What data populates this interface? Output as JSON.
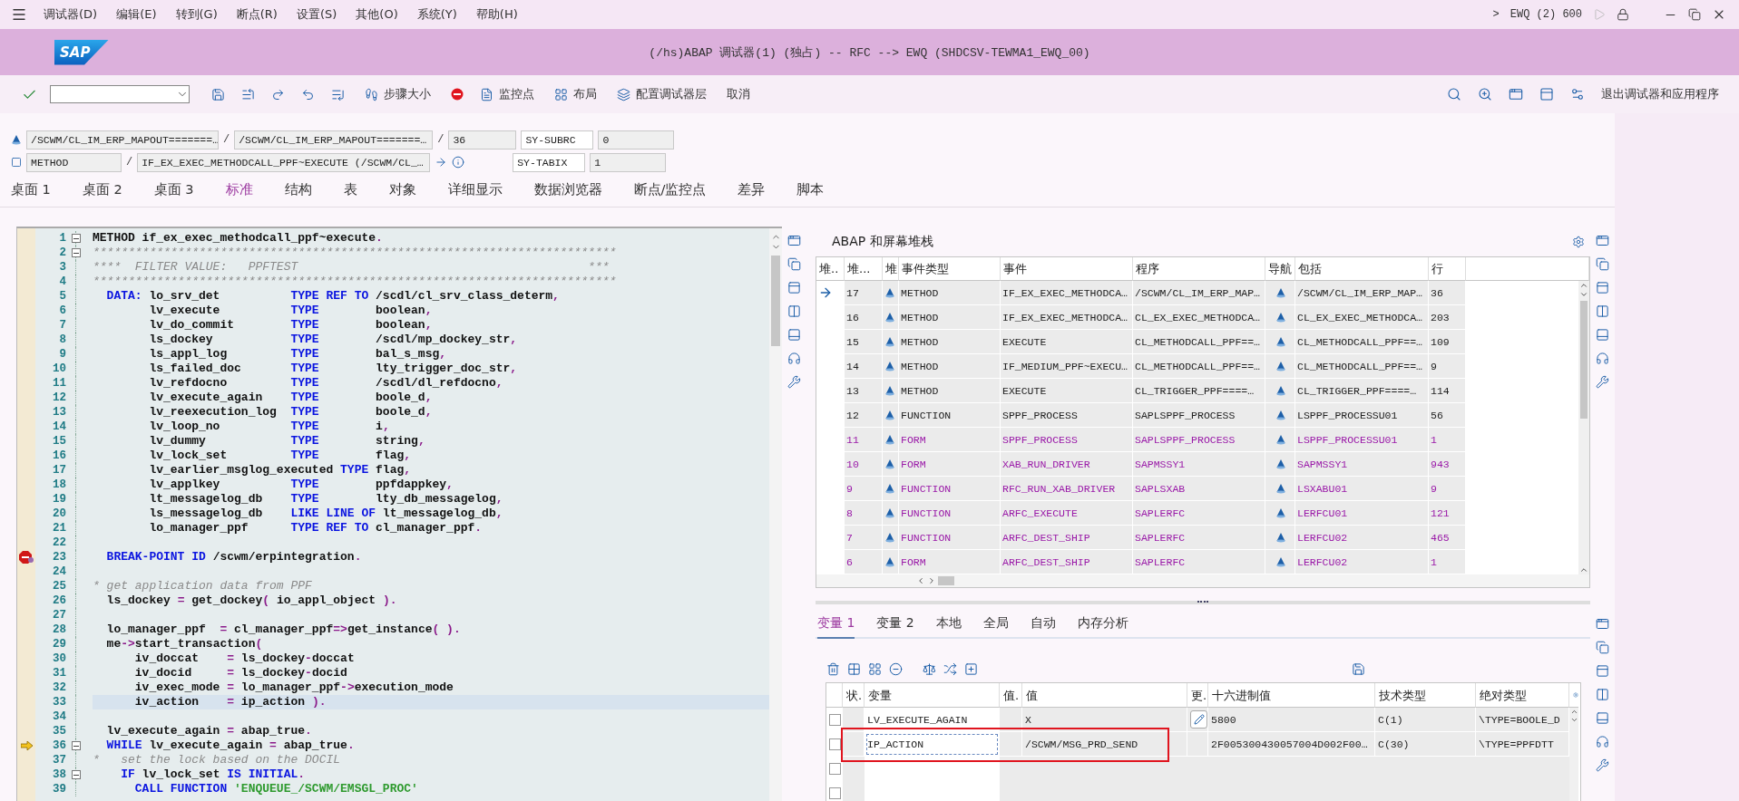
{
  "menu": {
    "items": [
      "调试器(D)",
      "编辑(E)",
      "转到(G)",
      "断点(R)",
      "设置(S)",
      "其他(O)",
      "系统(Y)",
      "帮助(H)"
    ],
    "expander": ">",
    "system": "EWQ (2) 600"
  },
  "title_bar": {
    "logo": "SAP",
    "title": "(/hs)ABAP 调试器(1) (独占) -- RFC --> EWQ (SHDCSV-TEWMA1_EWQ_00)"
  },
  "toolbar": {
    "labels": [
      "步骤大小",
      "监控点",
      "布局",
      "配置调试器层",
      "取消"
    ],
    "exit": "退出调试器和应用程序"
  },
  "location": {
    "program": "/SCWM/CL_IM_ERP_MAPOUT=======…",
    "sep1": "/",
    "include": "/SCWM/CL_IM_ERP_MAPOUT=======…",
    "sep2": "/",
    "line": "36",
    "event_type": "METHOD",
    "sep3": "/",
    "event": "IF_EX_EXEC_METHODCALL_PPF~EXECUTE (/SCWM/CL_…",
    "sy_fields": [
      {
        "name": "SY-SUBRC",
        "value": "0"
      },
      {
        "name": "SY-TABIX",
        "value": "1"
      }
    ]
  },
  "tabs": [
    {
      "label": "桌面 1",
      "selected": false
    },
    {
      "label": "桌面 2",
      "selected": false
    },
    {
      "label": "桌面 3",
      "selected": false
    },
    {
      "label": "标准",
      "selected": true
    },
    {
      "label": "结构",
      "selected": false
    },
    {
      "label": "表",
      "selected": false
    },
    {
      "label": "对象",
      "selected": false
    },
    {
      "label": "详细显示",
      "selected": false
    },
    {
      "label": "数据浏览器",
      "selected": false
    },
    {
      "label": "断点/监控点",
      "selected": false
    },
    {
      "label": "差异",
      "selected": false
    },
    {
      "label": "脚本",
      "selected": false
    }
  ],
  "code": [
    {
      "no": "1",
      "fold": true,
      "tokens": [
        {
          "kind": "name",
          "text": "METHOD if_ex_exec_methodcall_ppf~execute"
        },
        {
          "kind": "symbol",
          "text": "."
        }
      ]
    },
    {
      "no": "2",
      "fold": true,
      "tokens": [
        {
          "kind": "comment",
          "text": "**************************************************************************"
        }
      ]
    },
    {
      "no": "3",
      "tokens": [
        {
          "kind": "comment",
          "text": "****  FILTER VALUE:   PPFTEST                                         ***"
        }
      ]
    },
    {
      "no": "4",
      "tokens": [
        {
          "kind": "comment",
          "text": "**************************************************************************"
        }
      ]
    },
    {
      "no": "5",
      "tokens": [
        {
          "kind": "keyword",
          "text": "  DATA:"
        },
        {
          "kind": "name",
          "text": " lo_srv_det          "
        },
        {
          "kind": "keyword",
          "text": "TYPE REF TO"
        },
        {
          "kind": "name",
          "text": " /scdl/cl_srv_class_determ"
        },
        {
          "kind": "symbol",
          "text": ","
        }
      ]
    },
    {
      "no": "6",
      "tokens": [
        {
          "kind": "name",
          "text": "        lv_execute          "
        },
        {
          "kind": "keyword",
          "text": "TYPE"
        },
        {
          "kind": "name",
          "text": "        boolean"
        },
        {
          "kind": "symbol",
          "text": ","
        }
      ]
    },
    {
      "no": "7",
      "tokens": [
        {
          "kind": "name",
          "text": "        lv_do_commit        "
        },
        {
          "kind": "keyword",
          "text": "TYPE"
        },
        {
          "kind": "name",
          "text": "        boolean"
        },
        {
          "kind": "symbol",
          "text": ","
        }
      ]
    },
    {
      "no": "8",
      "tokens": [
        {
          "kind": "name",
          "text": "        ls_dockey           "
        },
        {
          "kind": "keyword",
          "text": "TYPE"
        },
        {
          "kind": "name",
          "text": "        /scdl/mp_dockey_str"
        },
        {
          "kind": "symbol",
          "text": ","
        }
      ]
    },
    {
      "no": "9",
      "tokens": [
        {
          "kind": "name",
          "text": "        ls_appl_log         "
        },
        {
          "kind": "keyword",
          "text": "TYPE"
        },
        {
          "kind": "name",
          "text": "        bal_s_msg"
        },
        {
          "kind": "symbol",
          "text": ","
        }
      ]
    },
    {
      "no": "10",
      "tokens": [
        {
          "kind": "name",
          "text": "        ls_failed_doc       "
        },
        {
          "kind": "keyword",
          "text": "TYPE"
        },
        {
          "kind": "name",
          "text": "        lty_trigger_doc_str"
        },
        {
          "kind": "symbol",
          "text": ","
        }
      ]
    },
    {
      "no": "11",
      "tokens": [
        {
          "kind": "name",
          "text": "        lv_refdocno         "
        },
        {
          "kind": "keyword",
          "text": "TYPE"
        },
        {
          "kind": "name",
          "text": "        /scdl/dl_refdocno"
        },
        {
          "kind": "symbol",
          "text": ","
        }
      ]
    },
    {
      "no": "12",
      "tokens": [
        {
          "kind": "name",
          "text": "        lv_execute_again    "
        },
        {
          "kind": "keyword",
          "text": "TYPE"
        },
        {
          "kind": "name",
          "text": "        boole_d"
        },
        {
          "kind": "symbol",
          "text": ","
        }
      ]
    },
    {
      "no": "13",
      "tokens": [
        {
          "kind": "name",
          "text": "        lv_reexecution_log  "
        },
        {
          "kind": "keyword",
          "text": "TYPE"
        },
        {
          "kind": "name",
          "text": "        boole_d"
        },
        {
          "kind": "symbol",
          "text": ","
        }
      ]
    },
    {
      "no": "14",
      "tokens": [
        {
          "kind": "name",
          "text": "        lv_loop_no          "
        },
        {
          "kind": "keyword",
          "text": "TYPE"
        },
        {
          "kind": "name",
          "text": "        i"
        },
        {
          "kind": "symbol",
          "text": ","
        }
      ]
    },
    {
      "no": "15",
      "tokens": [
        {
          "kind": "name",
          "text": "        lv_dummy            "
        },
        {
          "kind": "keyword",
          "text": "TYPE"
        },
        {
          "kind": "name",
          "text": "        string"
        },
        {
          "kind": "symbol",
          "text": ","
        }
      ]
    },
    {
      "no": "16",
      "tokens": [
        {
          "kind": "name",
          "text": "        lv_lock_set         "
        },
        {
          "kind": "keyword",
          "text": "TYPE"
        },
        {
          "kind": "name",
          "text": "        flag"
        },
        {
          "kind": "symbol",
          "text": ","
        }
      ]
    },
    {
      "no": "17",
      "tokens": [
        {
          "kind": "name",
          "text": "        lv_earlier_msglog_executed "
        },
        {
          "kind": "keyword",
          "text": "TYPE"
        },
        {
          "kind": "name",
          "text": " flag"
        },
        {
          "kind": "symbol",
          "text": ","
        }
      ]
    },
    {
      "no": "18",
      "tokens": [
        {
          "kind": "name",
          "text": "        lv_applkey          "
        },
        {
          "kind": "keyword",
          "text": "TYPE"
        },
        {
          "kind": "name",
          "text": "        ppfdappkey"
        },
        {
          "kind": "symbol",
          "text": ","
        }
      ]
    },
    {
      "no": "19",
      "tokens": [
        {
          "kind": "name",
          "text": "        lt_messagelog_db    "
        },
        {
          "kind": "keyword",
          "text": "TYPE"
        },
        {
          "kind": "name",
          "text": "        lty_db_messagelog"
        },
        {
          "kind": "symbol",
          "text": ","
        }
      ]
    },
    {
      "no": "20",
      "tokens": [
        {
          "kind": "name",
          "text": "        ls_messagelog_db    "
        },
        {
          "kind": "keyword",
          "text": "LIKE LINE OF"
        },
        {
          "kind": "name",
          "text": " lt_messagelog_db"
        },
        {
          "kind": "symbol",
          "text": ","
        }
      ]
    },
    {
      "no": "21",
      "tokens": [
        {
          "kind": "name",
          "text": "        lo_manager_ppf      "
        },
        {
          "kind": "keyword",
          "text": "TYPE REF TO"
        },
        {
          "kind": "name",
          "text": " cl_manager_ppf"
        },
        {
          "kind": "symbol",
          "text": "."
        }
      ]
    },
    {
      "no": "22"
    },
    {
      "no": "23",
      "breakpoint": true,
      "tokens": [
        {
          "kind": "keyword",
          "text": "  BREAK-POINT ID"
        },
        {
          "kind": "name",
          "text": " /scwm/erpintegration"
        },
        {
          "kind": "symbol",
          "text": "."
        }
      ]
    },
    {
      "no": "24"
    },
    {
      "no": "25",
      "tokens": [
        {
          "kind": "comment",
          "text": "* get application data from PPF"
        }
      ]
    },
    {
      "no": "26",
      "tokens": [
        {
          "kind": "name",
          "text": "  ls_dockey "
        },
        {
          "kind": "symbol",
          "text": "="
        },
        {
          "kind": "name",
          "text": " get_dockey"
        },
        {
          "kind": "symbol",
          "text": "("
        },
        {
          "kind": "name",
          "text": " io_appl_object "
        },
        {
          "kind": "symbol",
          "text": ")."
        }
      ]
    },
    {
      "no": "27"
    },
    {
      "no": "28",
      "tokens": [
        {
          "kind": "name",
          "text": "  lo_manager_ppf  "
        },
        {
          "kind": "symbol",
          "text": "="
        },
        {
          "kind": "name",
          "text": " cl_manager_ppf"
        },
        {
          "kind": "symbol",
          "text": "=>"
        },
        {
          "kind": "name",
          "text": "get_instance"
        },
        {
          "kind": "symbol",
          "text": "( )."
        }
      ]
    },
    {
      "no": "29",
      "tokens": [
        {
          "kind": "name",
          "text": "  me"
        },
        {
          "kind": "symbol",
          "text": "->"
        },
        {
          "kind": "name",
          "text": "start_transaction"
        },
        {
          "kind": "symbol",
          "text": "("
        }
      ]
    },
    {
      "no": "30",
      "tokens": [
        {
          "kind": "name",
          "text": "      iv_doccat    "
        },
        {
          "kind": "symbol",
          "text": "="
        },
        {
          "kind": "name",
          "text": " ls_dockey"
        },
        {
          "kind": "symbol",
          "text": "-"
        },
        {
          "kind": "name",
          "text": "doccat"
        }
      ]
    },
    {
      "no": "31",
      "tokens": [
        {
          "kind": "name",
          "text": "      iv_docid     "
        },
        {
          "kind": "symbol",
          "text": "="
        },
        {
          "kind": "name",
          "text": " ls_dockey"
        },
        {
          "kind": "symbol",
          "text": "-"
        },
        {
          "kind": "name",
          "text": "docid"
        }
      ]
    },
    {
      "no": "32",
      "tokens": [
        {
          "kind": "name",
          "text": "      iv_exec_mode "
        },
        {
          "kind": "symbol",
          "text": "="
        },
        {
          "kind": "name",
          "text": " lo_manager_ppf"
        },
        {
          "kind": "symbol",
          "text": "->"
        },
        {
          "kind": "name",
          "text": "execution_mode"
        }
      ]
    },
    {
      "no": "33",
      "highlighted": true,
      "tokens": [
        {
          "kind": "name",
          "text": "      iv_action    "
        },
        {
          "kind": "symbol",
          "text": "="
        },
        {
          "kind": "name",
          "text": " ip_action "
        },
        {
          "kind": "symbol",
          "text": ")."
        }
      ]
    },
    {
      "no": "34"
    },
    {
      "no": "35",
      "tokens": [
        {
          "kind": "name",
          "text": "  lv_execute_again "
        },
        {
          "kind": "symbol",
          "text": "="
        },
        {
          "kind": "name",
          "text": " abap_true"
        },
        {
          "kind": "symbol",
          "text": "."
        }
      ]
    },
    {
      "no": "36",
      "current": true,
      "fold": true,
      "tokens": [
        {
          "kind": "keyword",
          "text": "  WHILE"
        },
        {
          "kind": "name",
          "text": " lv_execute_again "
        },
        {
          "kind": "symbol",
          "text": "="
        },
        {
          "kind": "name",
          "text": " abap_true"
        },
        {
          "kind": "symbol",
          "text": "."
        }
      ]
    },
    {
      "no": "37",
      "tokens": [
        {
          "kind": "comment",
          "text": "*   set the lock based on the DOCIL"
        }
      ]
    },
    {
      "no": "38",
      "fold": true,
      "tokens": [
        {
          "kind": "keyword",
          "text": "    IF"
        },
        {
          "kind": "name",
          "text": " lv_lock_set "
        },
        {
          "kind": "keyword",
          "text": "IS INITIAL"
        },
        {
          "kind": "symbol",
          "text": "."
        }
      ]
    },
    {
      "no": "39",
      "tokens": [
        {
          "kind": "keyword",
          "text": "      CALL FUNCTION"
        },
        {
          "kind": "string",
          "text": " 'ENQUEUE_/SCWM/EMSGL_PROC'"
        }
      ]
    }
  ],
  "stack": {
    "title": "ABAP 和屏幕堆栈",
    "columns": [
      "堆..",
      "堆...",
      "堆",
      "事件类型",
      "事件",
      "程序",
      "导航",
      "包括",
      "行"
    ],
    "rows": [
      {
        "current": true,
        "system": false,
        "no": "17",
        "event_type": "METHOD",
        "event": "IF_EX_EXEC_METHODCA…",
        "program": "/SCWM/CL_IM_ERP_MAP…",
        "include": "/SCWM/CL_IM_ERP_MAP…",
        "line": "36"
      },
      {
        "current": false,
        "system": false,
        "no": "16",
        "event_type": "METHOD",
        "event": "IF_EX_EXEC_METHODCA…",
        "program": "CL_EX_EXEC_METHODCA…",
        "include": "CL_EX_EXEC_METHODCA…",
        "line": "203"
      },
      {
        "current": false,
        "system": false,
        "no": "15",
        "event_type": "METHOD",
        "event": "EXECUTE",
        "program": "CL_METHODCALL_PPF==…",
        "include": "CL_METHODCALL_PPF==…",
        "line": "109"
      },
      {
        "current": false,
        "system": false,
        "no": "14",
        "event_type": "METHOD",
        "event": "IF_MEDIUM_PPF~EXECU…",
        "program": "CL_METHODCALL_PPF==…",
        "include": "CL_METHODCALL_PPF==…",
        "line": "9"
      },
      {
        "current": false,
        "system": false,
        "no": "13",
        "event_type": "METHOD",
        "event": "EXECUTE",
        "program": "CL_TRIGGER_PPF====…",
        "include": "CL_TRIGGER_PPF====…",
        "line": "114"
      },
      {
        "current": false,
        "system": false,
        "no": "12",
        "event_type": "FUNCTION",
        "event": "SPPF_PROCESS",
        "program": "SAPLSPPF_PROCESS",
        "include": "LSPPF_PROCESSU01",
        "line": "56"
      },
      {
        "current": false,
        "system": true,
        "no": "11",
        "event_type": "FORM",
        "event": "SPPF_PROCESS",
        "program": "SAPLSPPF_PROCESS",
        "include": "LSPPF_PROCESSU01",
        "line": "1"
      },
      {
        "current": false,
        "system": true,
        "no": "10",
        "event_type": "FORM",
        "event": "XAB_RUN_DRIVER",
        "program": "SAPMSSY1",
        "include": "SAPMSSY1",
        "line": "943"
      },
      {
        "current": false,
        "system": true,
        "no": "9",
        "event_type": "FUNCTION",
        "event": "RFC_RUN_XAB_DRIVER",
        "program": "SAPLSXAB",
        "include": "LSXABU01",
        "line": "9"
      },
      {
        "current": false,
        "system": true,
        "no": "8",
        "event_type": "FUNCTION",
        "event": "ARFC_EXECUTE",
        "program": "SAPLERFC",
        "include": "LERFCU01",
        "line": "121"
      },
      {
        "current": false,
        "system": true,
        "no": "7",
        "event_type": "FUNCTION",
        "event": "ARFC_DEST_SHIP",
        "program": "SAPLERFC",
        "include": "LERFCU02",
        "line": "465"
      },
      {
        "current": false,
        "system": true,
        "no": "6",
        "event_type": "FORM",
        "event": "ARFC_DEST_SHIP",
        "program": "SAPLERFC",
        "include": "LERFCU02",
        "line": "1"
      }
    ]
  },
  "variable_tabs": [
    {
      "label": "变量 1",
      "selected": true
    },
    {
      "label": "变量 2",
      "selected": false
    },
    {
      "label": "本地",
      "selected": false
    },
    {
      "label": "全局",
      "selected": false
    },
    {
      "label": "自动",
      "selected": false
    },
    {
      "label": "内存分析",
      "selected": false
    }
  ],
  "variables": {
    "columns": [
      "状.",
      "变量",
      "值.",
      "值",
      "更.",
      "十六进制值",
      "技术类型",
      "绝对类型"
    ],
    "rows": [
      {
        "selected": false,
        "highlighted": false,
        "editable": true,
        "name": "LV_EXECUTE_AGAIN",
        "value": "X",
        "hex": "5800",
        "tech_type": "C(1)",
        "abs_type": "\\TYPE=BOOLE_D"
      },
      {
        "selected": true,
        "highlighted": true,
        "editable": false,
        "name": "IP_ACTION",
        "value": "/SCWM/MSG_PRD_SEND",
        "hex": "2F005300430057004D002F00…",
        "tech_type": "C(30)",
        "abs_type": "\\TYPE=PPFDTT"
      }
    ]
  }
}
